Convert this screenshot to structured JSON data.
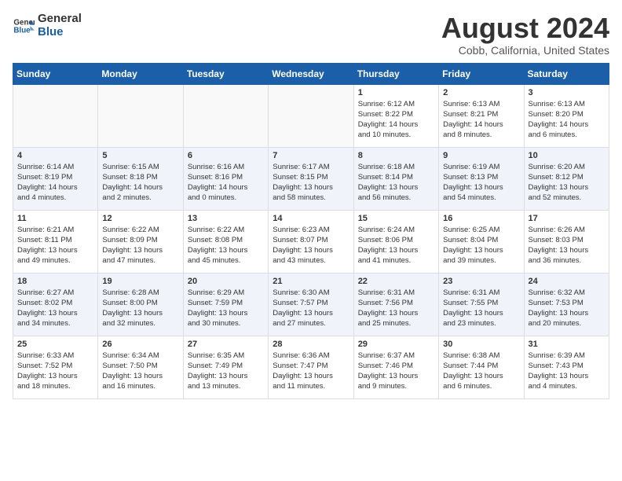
{
  "header": {
    "logo_line1": "General",
    "logo_line2": "Blue",
    "month_title": "August 2024",
    "subtitle": "Cobb, California, United States"
  },
  "weekdays": [
    "Sunday",
    "Monday",
    "Tuesday",
    "Wednesday",
    "Thursday",
    "Friday",
    "Saturday"
  ],
  "weeks": [
    [
      {
        "day": "",
        "info": ""
      },
      {
        "day": "",
        "info": ""
      },
      {
        "day": "",
        "info": ""
      },
      {
        "day": "",
        "info": ""
      },
      {
        "day": "1",
        "info": "Sunrise: 6:12 AM\nSunset: 8:22 PM\nDaylight: 14 hours\nand 10 minutes."
      },
      {
        "day": "2",
        "info": "Sunrise: 6:13 AM\nSunset: 8:21 PM\nDaylight: 14 hours\nand 8 minutes."
      },
      {
        "day": "3",
        "info": "Sunrise: 6:13 AM\nSunset: 8:20 PM\nDaylight: 14 hours\nand 6 minutes."
      }
    ],
    [
      {
        "day": "4",
        "info": "Sunrise: 6:14 AM\nSunset: 8:19 PM\nDaylight: 14 hours\nand 4 minutes."
      },
      {
        "day": "5",
        "info": "Sunrise: 6:15 AM\nSunset: 8:18 PM\nDaylight: 14 hours\nand 2 minutes."
      },
      {
        "day": "6",
        "info": "Sunrise: 6:16 AM\nSunset: 8:16 PM\nDaylight: 14 hours\nand 0 minutes."
      },
      {
        "day": "7",
        "info": "Sunrise: 6:17 AM\nSunset: 8:15 PM\nDaylight: 13 hours\nand 58 minutes."
      },
      {
        "day": "8",
        "info": "Sunrise: 6:18 AM\nSunset: 8:14 PM\nDaylight: 13 hours\nand 56 minutes."
      },
      {
        "day": "9",
        "info": "Sunrise: 6:19 AM\nSunset: 8:13 PM\nDaylight: 13 hours\nand 54 minutes."
      },
      {
        "day": "10",
        "info": "Sunrise: 6:20 AM\nSunset: 8:12 PM\nDaylight: 13 hours\nand 52 minutes."
      }
    ],
    [
      {
        "day": "11",
        "info": "Sunrise: 6:21 AM\nSunset: 8:11 PM\nDaylight: 13 hours\nand 49 minutes."
      },
      {
        "day": "12",
        "info": "Sunrise: 6:22 AM\nSunset: 8:09 PM\nDaylight: 13 hours\nand 47 minutes."
      },
      {
        "day": "13",
        "info": "Sunrise: 6:22 AM\nSunset: 8:08 PM\nDaylight: 13 hours\nand 45 minutes."
      },
      {
        "day": "14",
        "info": "Sunrise: 6:23 AM\nSunset: 8:07 PM\nDaylight: 13 hours\nand 43 minutes."
      },
      {
        "day": "15",
        "info": "Sunrise: 6:24 AM\nSunset: 8:06 PM\nDaylight: 13 hours\nand 41 minutes."
      },
      {
        "day": "16",
        "info": "Sunrise: 6:25 AM\nSunset: 8:04 PM\nDaylight: 13 hours\nand 39 minutes."
      },
      {
        "day": "17",
        "info": "Sunrise: 6:26 AM\nSunset: 8:03 PM\nDaylight: 13 hours\nand 36 minutes."
      }
    ],
    [
      {
        "day": "18",
        "info": "Sunrise: 6:27 AM\nSunset: 8:02 PM\nDaylight: 13 hours\nand 34 minutes."
      },
      {
        "day": "19",
        "info": "Sunrise: 6:28 AM\nSunset: 8:00 PM\nDaylight: 13 hours\nand 32 minutes."
      },
      {
        "day": "20",
        "info": "Sunrise: 6:29 AM\nSunset: 7:59 PM\nDaylight: 13 hours\nand 30 minutes."
      },
      {
        "day": "21",
        "info": "Sunrise: 6:30 AM\nSunset: 7:57 PM\nDaylight: 13 hours\nand 27 minutes."
      },
      {
        "day": "22",
        "info": "Sunrise: 6:31 AM\nSunset: 7:56 PM\nDaylight: 13 hours\nand 25 minutes."
      },
      {
        "day": "23",
        "info": "Sunrise: 6:31 AM\nSunset: 7:55 PM\nDaylight: 13 hours\nand 23 minutes."
      },
      {
        "day": "24",
        "info": "Sunrise: 6:32 AM\nSunset: 7:53 PM\nDaylight: 13 hours\nand 20 minutes."
      }
    ],
    [
      {
        "day": "25",
        "info": "Sunrise: 6:33 AM\nSunset: 7:52 PM\nDaylight: 13 hours\nand 18 minutes."
      },
      {
        "day": "26",
        "info": "Sunrise: 6:34 AM\nSunset: 7:50 PM\nDaylight: 13 hours\nand 16 minutes."
      },
      {
        "day": "27",
        "info": "Sunrise: 6:35 AM\nSunset: 7:49 PM\nDaylight: 13 hours\nand 13 minutes."
      },
      {
        "day": "28",
        "info": "Sunrise: 6:36 AM\nSunset: 7:47 PM\nDaylight: 13 hours\nand 11 minutes."
      },
      {
        "day": "29",
        "info": "Sunrise: 6:37 AM\nSunset: 7:46 PM\nDaylight: 13 hours\nand 9 minutes."
      },
      {
        "day": "30",
        "info": "Sunrise: 6:38 AM\nSunset: 7:44 PM\nDaylight: 13 hours\nand 6 minutes."
      },
      {
        "day": "31",
        "info": "Sunrise: 6:39 AM\nSunset: 7:43 PM\nDaylight: 13 hours\nand 4 minutes."
      }
    ]
  ]
}
